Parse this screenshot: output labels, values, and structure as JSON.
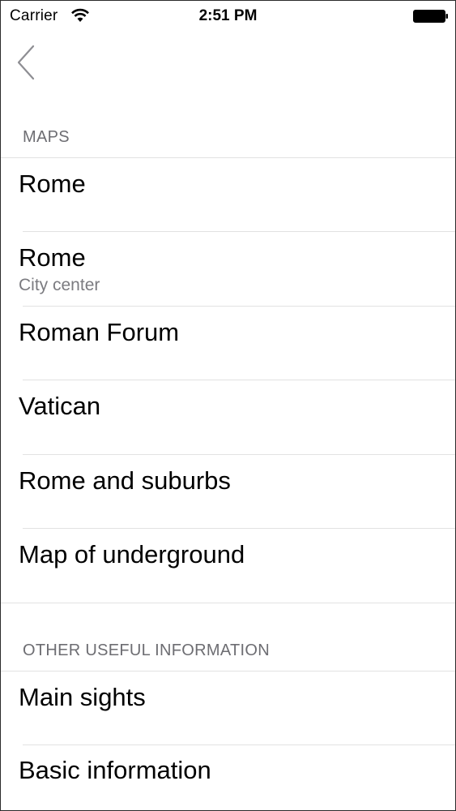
{
  "status_bar": {
    "carrier": "Carrier",
    "time": "2:51 PM",
    "wifi_icon": "wifi-icon",
    "battery_icon": "battery-icon"
  },
  "nav": {
    "back_icon": "chevron-left-icon"
  },
  "sections": [
    {
      "header": "MAPS",
      "items": [
        {
          "title": "Rome",
          "subtitle": ""
        },
        {
          "title": "Rome",
          "subtitle": "City center"
        },
        {
          "title": "Roman Forum",
          "subtitle": ""
        },
        {
          "title": "Vatican",
          "subtitle": ""
        },
        {
          "title": "Rome and suburbs",
          "subtitle": ""
        },
        {
          "title": "Map of underground",
          "subtitle": ""
        }
      ]
    },
    {
      "header": "OTHER USEFUL INFORMATION",
      "items": [
        {
          "title": "Main sights",
          "subtitle": ""
        },
        {
          "title": "Basic information",
          "subtitle": ""
        }
      ]
    }
  ],
  "colors": {
    "section_header": "#6d6d72",
    "subtitle": "#7b7b80",
    "divider": "#e2e2e2"
  }
}
